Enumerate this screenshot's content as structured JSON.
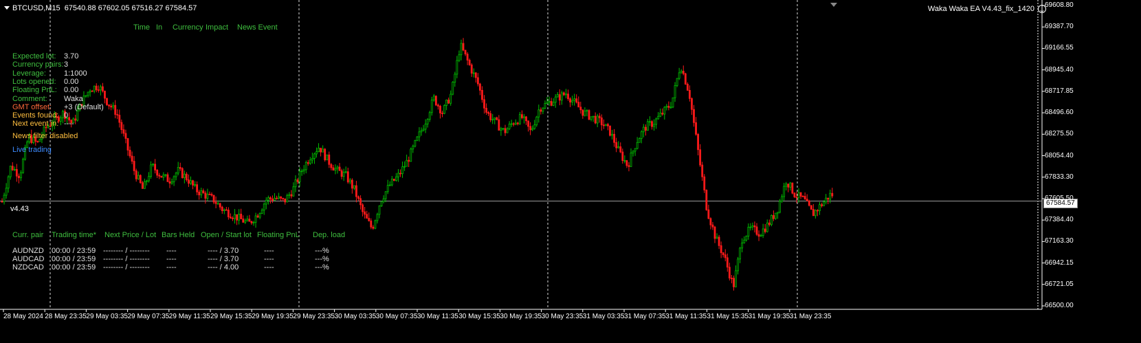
{
  "header": {
    "symbol": "BTCUSD,M15",
    "ohlc": "67540.88 67602.05 67516.27 67584.57",
    "ea_name": "Waka Waka EA  V4.43_fix_1420"
  },
  "news_columns": [
    "Time",
    "In",
    "Currency",
    "Impact",
    "News Event"
  ],
  "info_panel": [
    {
      "label": "Expected lot:",
      "value": "3.70",
      "color": "#3fbf3f"
    },
    {
      "label": "Currency pairs:",
      "value": "3",
      "color": "#3fbf3f"
    },
    {
      "label": "Leverage:",
      "value": "1:1000",
      "color": "#3fbf3f"
    },
    {
      "label": "Lots opened:",
      "value": "0.00",
      "color": "#3fbf3f"
    },
    {
      "label": "Floating PnL:",
      "value": "0.00",
      "color": "#3fbf3f"
    },
    {
      "label": "Comment:",
      "value": "Waka",
      "color": "#3fbf3f"
    },
    {
      "label": "GMT offset:",
      "value": "+3 (Default)",
      "color": "#ff6a3a"
    },
    {
      "label": "Events found:",
      "value": "0",
      "color": "#ffbf3f"
    },
    {
      "label": "Next event in:",
      "value": "----",
      "color": "#ffbf3f"
    }
  ],
  "news_filter_status": "News filter disabled",
  "mode_status": "Live trading",
  "version": "v4.43",
  "pairs_table": {
    "headers": [
      "Curr. pair",
      "Trading time*",
      "Next Price / Lot",
      "Bars Held",
      "Open / Start lot",
      "Floating PnL",
      "Dep. load"
    ],
    "rows": [
      [
        "AUDNZD",
        "00:00 / 23:59",
        "-------- / --------",
        "----",
        "---- / 3.70",
        "----",
        "---%"
      ],
      [
        "AUDCAD",
        "00:00 / 23:59",
        "-------- / --------",
        "----",
        "---- / 3.70",
        "----",
        "---%"
      ],
      [
        "NZDCAD",
        "00:00 / 23:59",
        "-------- / --------",
        "----",
        "---- / 4.00",
        "----",
        "---%"
      ]
    ]
  },
  "current_price": "67584.57",
  "chart_data": {
    "type": "candlestick",
    "y_ticks": [
      "69608.80",
      "69387.70",
      "69166.55",
      "68945.40",
      "68717.85",
      "68496.60",
      "68275.50",
      "68054.40",
      "67833.30",
      "67605.50",
      "67384.40",
      "67163.30",
      "66942.15",
      "66721.05",
      "66500.00"
    ],
    "ylim": [
      66500.0,
      69608.8
    ],
    "x_ticks": [
      "28 May 2024",
      "28 May 23:35",
      "29 May 03:35",
      "29 May 07:35",
      "29 May 11:35",
      "29 May 15:35",
      "29 May 19:35",
      "29 May 23:35",
      "30 May 03:35",
      "30 May 07:35",
      "30 May 11:35",
      "30 May 15:35",
      "30 May 19:35",
      "30 May 23:35",
      "31 May 03:35",
      "31 May 07:35",
      "31 May 11:35",
      "31 May 15:35",
      "31 May 19:35",
      "31 May 23:35"
    ],
    "close_path": [
      67580,
      67950,
      67850,
      68250,
      68180,
      68350,
      68420,
      68500,
      68380,
      68600,
      68750,
      68780,
      68600,
      68500,
      68200,
      67900,
      67700,
      67950,
      67850,
      67800,
      67900,
      67820,
      67700,
      67650,
      67600,
      67500,
      67450,
      67400,
      67350,
      67450,
      67600,
      67620,
      67580,
      67700,
      67900,
      68050,
      68150,
      68000,
      67900,
      67850,
      67700,
      67450,
      67300,
      67600,
      67750,
      67850,
      68000,
      68200,
      68400,
      68650,
      68500,
      68700,
      69200,
      69000,
      68800,
      68500,
      68400,
      68300,
      68400,
      68450,
      68300,
      68550,
      68600,
      68650,
      68700,
      68600,
      68500,
      68450,
      68400,
      68300,
      68100,
      67950,
      68200,
      68350,
      68400,
      68500,
      68600,
      69000,
      68700,
      68100,
      67500,
      67200,
      67000,
      66700,
      67200,
      67300,
      67250,
      67350,
      67500,
      67800,
      67650,
      67600,
      67450,
      67550,
      67650
    ]
  }
}
